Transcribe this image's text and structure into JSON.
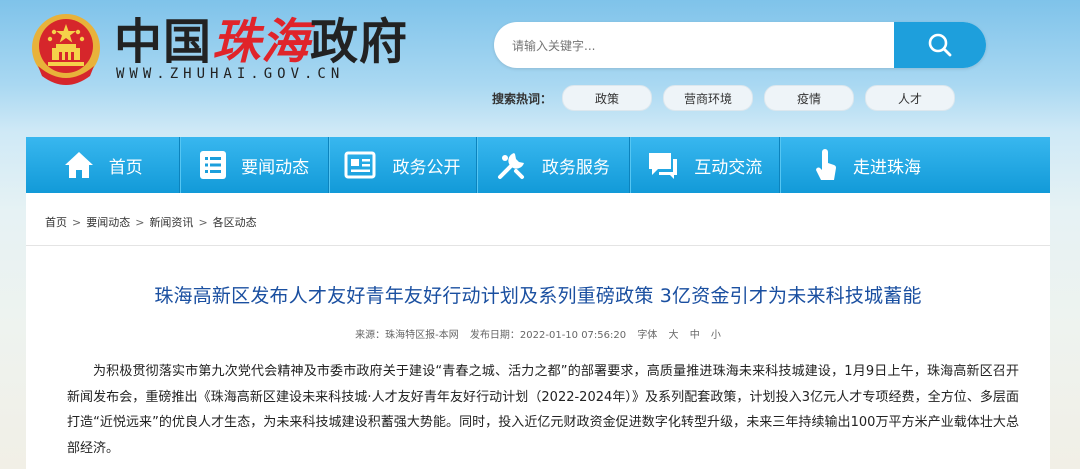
{
  "site": {
    "title_part1": "中国",
    "title_part2": "珠海",
    "title_part3": "政府",
    "url": "WWW.ZHUHAI.GOV.CN"
  },
  "search": {
    "placeholder": "请输入关键字...",
    "button_icon": "search-icon"
  },
  "hot_search": {
    "label": "搜索热词：",
    "tags": [
      "政策",
      "营商环境",
      "疫情",
      "人才"
    ]
  },
  "nav": [
    {
      "label": "首页",
      "icon": "home-icon"
    },
    {
      "label": "要闻动态",
      "icon": "news-list-icon"
    },
    {
      "label": "政务公开",
      "icon": "document-icon"
    },
    {
      "label": "政务服务",
      "icon": "service-icon"
    },
    {
      "label": "互动交流",
      "icon": "chat-icon"
    },
    {
      "label": "走进珠海",
      "icon": "touch-icon"
    }
  ],
  "breadcrumb": [
    "首页",
    "要闻动态",
    "新闻资讯",
    "各区动态"
  ],
  "article": {
    "title": "珠海高新区发布人才友好青年友好行动计划及系列重磅政策 3亿资金引才为未来科技城蓄能",
    "source": "来源：珠海特区报-本网",
    "date": "发布日期：2022-01-10 07:56:20",
    "font_label": "字体",
    "font_sizes": [
      "大",
      "中",
      "小"
    ],
    "body": "为积极贯彻落实市第九次党代会精神及市委市政府关于建设“青春之城、活力之都”的部署要求，高质量推进珠海未来科技城建设，1月9日上午，珠海高新区召开新闻发布会，重磅推出《珠海高新区建设未来科技城·人才友好青年友好行动计划（2022-2024年）》及系列配套政策，计划投入3亿元人才专项经费，全方位、多层面打造“近悦远来”的优良人才生态，为未来科技城建设积蓄强大势能。同时，投入近亿元财政资金促进数字化转型升级，未来三年持续输出100万平方米产业载体壮大总部经济。"
  },
  "colors": {
    "nav_bg": "#1ea4e0",
    "search_button": "#1e9fdc",
    "title_blue": "#1a4fa0",
    "brand_red": "#e0242a"
  }
}
